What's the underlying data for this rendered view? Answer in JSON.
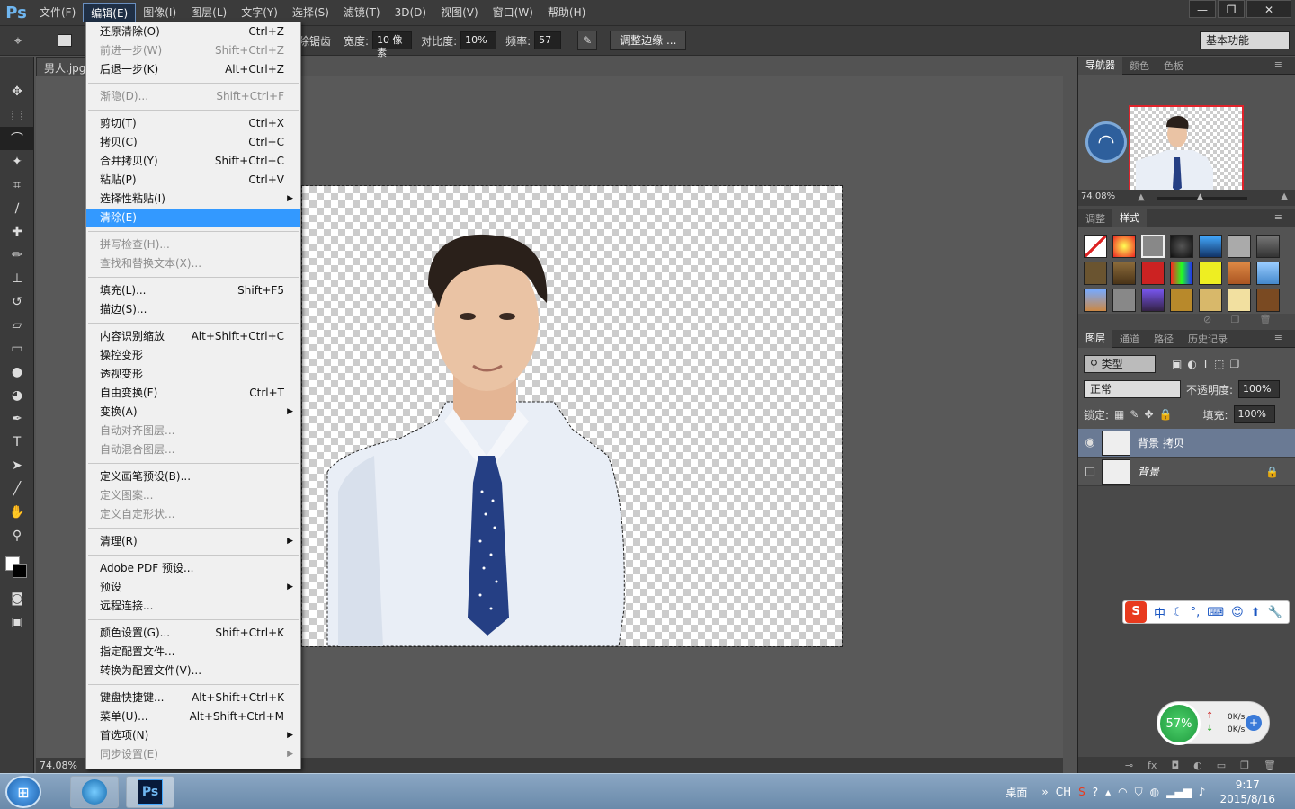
{
  "menubar": {
    "logo": "Ps",
    "items": [
      "文件(F)",
      "编辑(E)",
      "图像(I)",
      "图层(L)",
      "文字(Y)",
      "选择(S)",
      "滤镜(T)",
      "3D(D)",
      "视图(V)",
      "窗口(W)",
      "帮助(H)"
    ]
  },
  "window": {
    "minimize": "—",
    "restore": "❐",
    "close": "✕"
  },
  "options": {
    "antialias_label": "消除锯齿",
    "width_label": "宽度:",
    "width_value": "10 像素",
    "contrast_label": "对比度:",
    "contrast_value": "10%",
    "frequency_label": "频率:",
    "frequency_value": "57",
    "refine_edge_button": "调整边缘 ...",
    "workspace": "基本功能"
  },
  "document": {
    "tab": "男人.jpg",
    "zoom": "74.08%"
  },
  "edit_menu": {
    "groups": [
      [
        {
          "label": "还原清除(O)",
          "shortcut": "Ctrl+Z"
        },
        {
          "label": "前进一步(W)",
          "shortcut": "Shift+Ctrl+Z",
          "disabled": true
        },
        {
          "label": "后退一步(K)",
          "shortcut": "Alt+Ctrl+Z"
        }
      ],
      [
        {
          "label": "渐隐(D)...",
          "shortcut": "Shift+Ctrl+F",
          "disabled": true
        }
      ],
      [
        {
          "label": "剪切(T)",
          "shortcut": "Ctrl+X"
        },
        {
          "label": "拷贝(C)",
          "shortcut": "Ctrl+C"
        },
        {
          "label": "合并拷贝(Y)",
          "shortcut": "Shift+Ctrl+C"
        },
        {
          "label": "粘贴(P)",
          "shortcut": "Ctrl+V"
        },
        {
          "label": "选择性粘贴(I)",
          "submenu": true
        },
        {
          "label": "清除(E)",
          "highlighted": true
        }
      ],
      [
        {
          "label": "拼写检查(H)...",
          "disabled": true
        },
        {
          "label": "查找和替换文本(X)...",
          "disabled": true
        }
      ],
      [
        {
          "label": "填充(L)...",
          "shortcut": "Shift+F5"
        },
        {
          "label": "描边(S)..."
        }
      ],
      [
        {
          "label": "内容识别缩放",
          "shortcut": "Alt+Shift+Ctrl+C"
        },
        {
          "label": "操控变形"
        },
        {
          "label": "透视变形"
        },
        {
          "label": "自由变换(F)",
          "shortcut": "Ctrl+T"
        },
        {
          "label": "变换(A)",
          "submenu": true
        },
        {
          "label": "自动对齐图层...",
          "disabled": true
        },
        {
          "label": "自动混合图层...",
          "disabled": true
        }
      ],
      [
        {
          "label": "定义画笔预设(B)..."
        },
        {
          "label": "定义图案...",
          "disabled": true
        },
        {
          "label": "定义自定形状...",
          "disabled": true
        }
      ],
      [
        {
          "label": "清理(R)",
          "submenu": true
        }
      ],
      [
        {
          "label": "Adobe PDF 预设..."
        },
        {
          "label": "预设",
          "submenu": true
        },
        {
          "label": "远程连接..."
        }
      ],
      [
        {
          "label": "颜色设置(G)...",
          "shortcut": "Shift+Ctrl+K"
        },
        {
          "label": "指定配置文件..."
        },
        {
          "label": "转换为配置文件(V)..."
        }
      ],
      [
        {
          "label": "键盘快捷键...",
          "shortcut": "Alt+Shift+Ctrl+K"
        },
        {
          "label": "菜单(U)...",
          "shortcut": "Alt+Shift+Ctrl+M"
        },
        {
          "label": "首选项(N)",
          "submenu": true
        },
        {
          "label": "同步设置(E)",
          "submenu": true,
          "disabled": true
        }
      ]
    ]
  },
  "navigator": {
    "tabs": [
      "导航器",
      "颜色",
      "色板"
    ],
    "zoom": "74.08%"
  },
  "styles_panel": {
    "tabs": [
      "调整",
      "样式"
    ]
  },
  "layers_panel": {
    "tabs": [
      "图层",
      "通道",
      "路径",
      "历史记录"
    ],
    "filter_kind": "类型",
    "blend_mode": "正常",
    "opacity_label": "不透明度:",
    "opacity_value": "100%",
    "lock_label": "锁定:",
    "fill_label": "填充:",
    "fill_value": "100%",
    "layers": [
      {
        "name": "背景 拷贝",
        "visible": true,
        "selected": true
      },
      {
        "name": "背景",
        "visible": false,
        "locked": true
      }
    ]
  },
  "ime": {
    "label": "中"
  },
  "net_widget": {
    "percent": "57%",
    "up": "0K/s",
    "down": "0K/s"
  },
  "taskbar": {
    "desktop_label": "桌面",
    "lang": "CH",
    "time": "9:17",
    "date": "2015/8/16",
    "ps_label": "Ps"
  },
  "colors": {
    "accent": "#3399ff",
    "panel": "#494949",
    "chrome": "#3b3b3b",
    "selection_red": "#e0222a"
  }
}
